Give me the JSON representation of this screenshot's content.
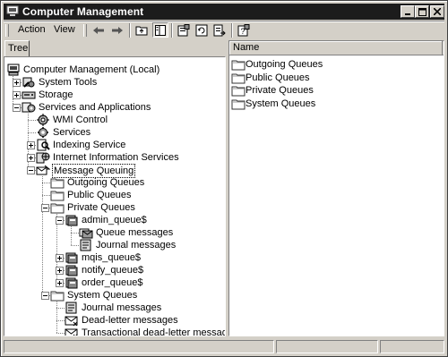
{
  "window": {
    "title": "Computer Management"
  },
  "menu": {
    "action": "Action",
    "view": "View"
  },
  "left_pane": {
    "tab_label": "Tree"
  },
  "right_pane": {
    "column_name": "Name"
  },
  "tree": [
    {
      "label": "Computer Management (Local)",
      "icon": "computer-icon"
    },
    {
      "label": "System Tools",
      "icon": "tools-icon"
    },
    {
      "label": "Storage",
      "icon": "storage-icon"
    },
    {
      "label": "Services and Applications",
      "icon": "services-icon"
    },
    {
      "label": "WMI Control",
      "icon": "wmi-icon"
    },
    {
      "label": "Services",
      "icon": "gear-icon"
    },
    {
      "label": "Indexing Service",
      "icon": "indexing-icon"
    },
    {
      "label": "Internet Information Services",
      "icon": "iis-icon"
    },
    {
      "label": "Message Queuing",
      "icon": "message-queuing-icon"
    },
    {
      "label": "Outgoing Queues",
      "icon": "folder-icon"
    },
    {
      "label": "Public Queues",
      "icon": "folder-icon"
    },
    {
      "label": "Private Queues",
      "icon": "folder-icon"
    },
    {
      "label": "admin_queue$",
      "icon": "queue-icon"
    },
    {
      "label": "Queue messages",
      "icon": "queue-messages-icon"
    },
    {
      "label": "Journal messages",
      "icon": "journal-icon"
    },
    {
      "label": "mqis_queue$",
      "icon": "queue-icon"
    },
    {
      "label": "notify_queue$",
      "icon": "queue-icon"
    },
    {
      "label": "order_queue$",
      "icon": "queue-icon"
    },
    {
      "label": "System Queues",
      "icon": "folder-icon"
    },
    {
      "label": "Journal messages",
      "icon": "journal-icon"
    },
    {
      "label": "Dead-letter messages",
      "icon": "dead-letter-icon"
    },
    {
      "label": "Transactional dead-letter messages",
      "icon": "dead-letter-icon"
    }
  ],
  "list": [
    {
      "label": "Outgoing Queues",
      "icon": "folder-icon"
    },
    {
      "label": "Public Queues",
      "icon": "folder-icon"
    },
    {
      "label": "Private Queues",
      "icon": "folder-icon"
    },
    {
      "label": "System Queues",
      "icon": "folder-icon"
    }
  ]
}
